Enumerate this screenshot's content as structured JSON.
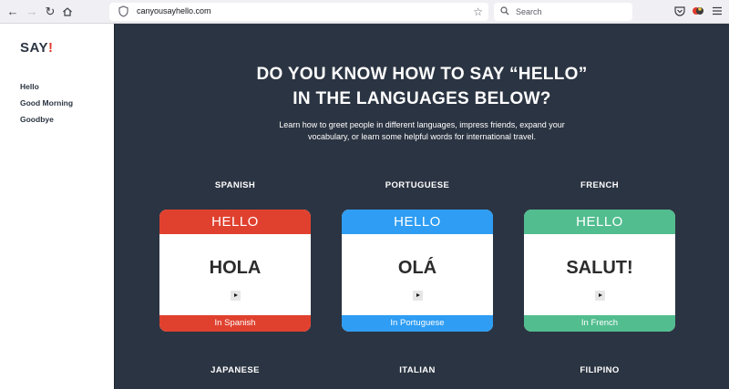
{
  "browser": {
    "url": "canyousayhello.com",
    "search_placeholder": "Search",
    "icons": [
      "back-arrow-icon",
      "forward-arrow-icon",
      "reload-icon",
      "home-icon",
      "shield-icon",
      "bookmark-star-icon",
      "search-icon",
      "pocket-icon",
      "extension-icon",
      "menu-icon"
    ]
  },
  "sidebar": {
    "logo_text": "SAY",
    "logo_bang": "!",
    "items": [
      {
        "label": "Hello"
      },
      {
        "label": "Good Morning"
      },
      {
        "label": "Goodbye"
      }
    ]
  },
  "main": {
    "headline_line1": "DO YOU KNOW HOW TO SAY “HELLO”",
    "headline_line2": "IN THE LANGUAGES BELOW?",
    "intro_line1": "Learn how to greet people in different languages, impress friends, expand your",
    "intro_line2": "vocabulary, or learn some helpful words for international travel."
  },
  "cards": [
    {
      "language": "SPANISH",
      "cap": "HELLO",
      "word": "HOLA",
      "footer": "In Spanish",
      "color": "#e0412f"
    },
    {
      "language": "PORTUGUESE",
      "cap": "HELLO",
      "word": "OLÁ",
      "footer": "In Portuguese",
      "color": "#2e9df3"
    },
    {
      "language": "FRENCH",
      "cap": "HELLO",
      "word": "SALUT!",
      "footer": "In French",
      "color": "#52bd8f"
    }
  ],
  "next_row": [
    {
      "language": "JAPANESE"
    },
    {
      "language": "ITALIAN"
    },
    {
      "language": "FILIPINO"
    }
  ]
}
